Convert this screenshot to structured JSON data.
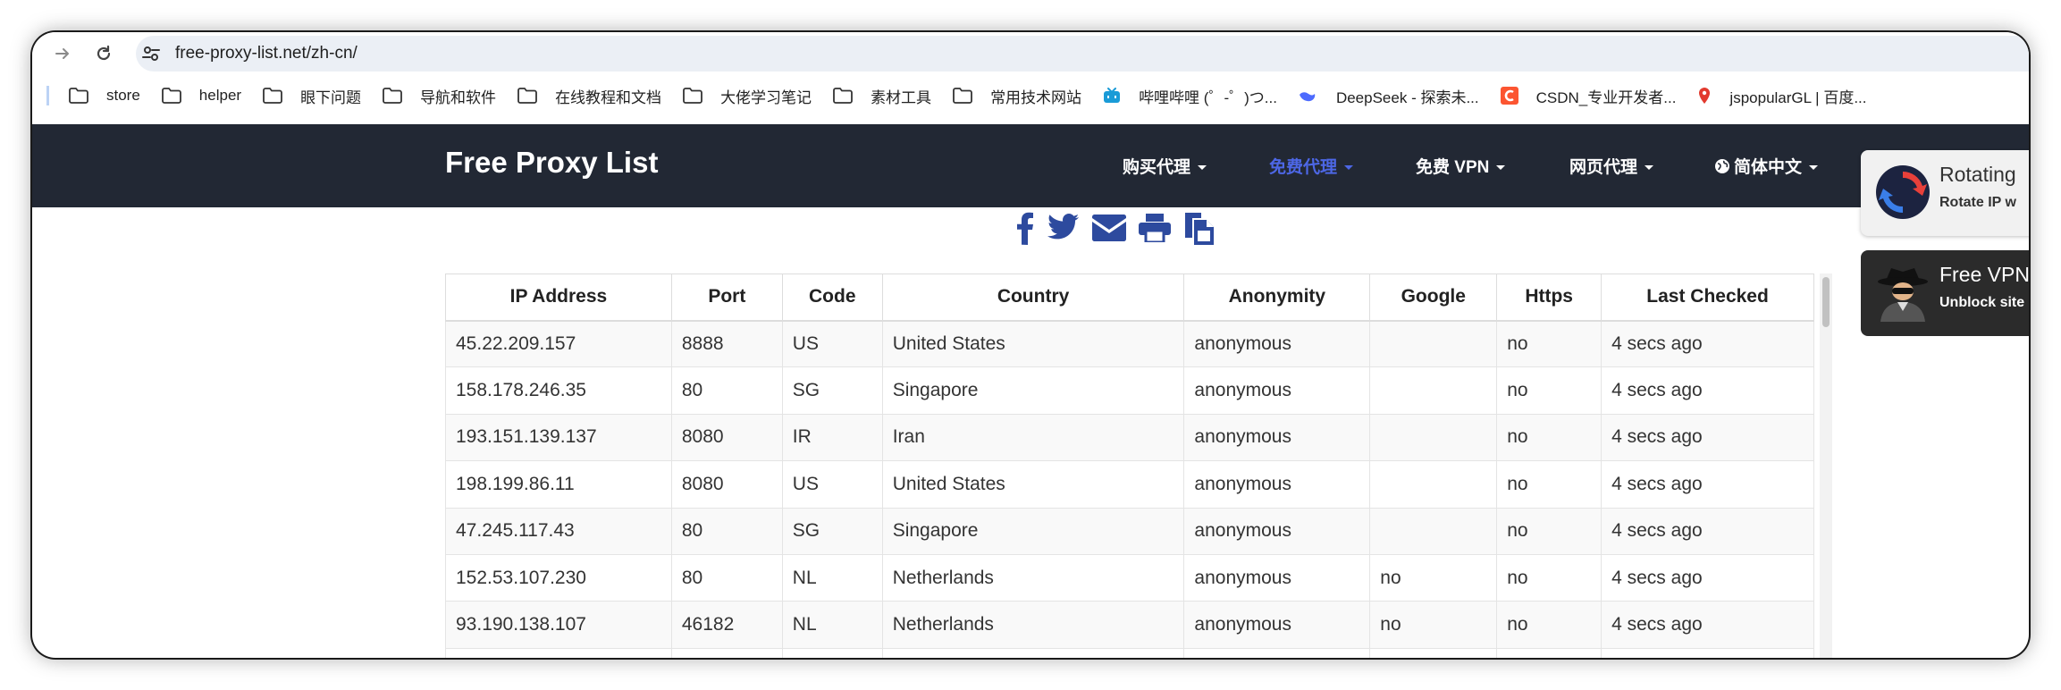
{
  "browser": {
    "url": "free-proxy-list.net/zh-cn/",
    "bookmarks": [
      {
        "label": "store",
        "icon": "folder-icon"
      },
      {
        "label": "helper",
        "icon": "folder-icon"
      },
      {
        "label": "眼下问题",
        "icon": "folder-icon"
      },
      {
        "label": "导航和软件",
        "icon": "folder-icon"
      },
      {
        "label": "在线教程和文档",
        "icon": "folder-icon"
      },
      {
        "label": "大佬学习笔记",
        "icon": "folder-icon"
      },
      {
        "label": "素材工具",
        "icon": "folder-icon"
      },
      {
        "label": "常用技术网站",
        "icon": "folder-icon"
      },
      {
        "label": "哔哩哔哩 (゜-゜)つ...",
        "icon": "bilibili-icon"
      },
      {
        "label": "DeepSeek - 探索未...",
        "icon": "deepseek-icon"
      },
      {
        "label": "CSDN_专业开发者...",
        "icon": "csdn-icon"
      },
      {
        "label": "jspopularGL | 百度...",
        "icon": "map-pin-icon"
      }
    ]
  },
  "site": {
    "brand": "Free Proxy List",
    "menu": [
      {
        "label": "购买代理",
        "active": false
      },
      {
        "label": "免费代理",
        "active": true
      },
      {
        "label": "免费 VPN",
        "active": false
      },
      {
        "label": "网页代理",
        "active": false
      },
      {
        "label": "简体中文",
        "active": false,
        "icon": "globe-icon"
      }
    ],
    "accent_color": "#4d67e6",
    "header_color": "#222834",
    "share_color": "#2d4a9e"
  },
  "share_icons": [
    "facebook-icon",
    "twitter-icon",
    "email-icon",
    "print-icon",
    "copy-icon"
  ],
  "table": {
    "headers": [
      "IP Address",
      "Port",
      "Code",
      "Country",
      "Anonymity",
      "Google",
      "Https",
      "Last Checked"
    ],
    "rows": [
      [
        "45.22.209.157",
        "8888",
        "US",
        "United States",
        "anonymous",
        "",
        "no",
        "4 secs ago"
      ],
      [
        "158.178.246.35",
        "80",
        "SG",
        "Singapore",
        "anonymous",
        "",
        "no",
        "4 secs ago"
      ],
      [
        "193.151.139.137",
        "8080",
        "IR",
        "Iran",
        "anonymous",
        "",
        "no",
        "4 secs ago"
      ],
      [
        "198.199.86.11",
        "8080",
        "US",
        "United States",
        "anonymous",
        "",
        "no",
        "4 secs ago"
      ],
      [
        "47.245.117.43",
        "80",
        "SG",
        "Singapore",
        "anonymous",
        "",
        "no",
        "4 secs ago"
      ],
      [
        "152.53.107.230",
        "80",
        "NL",
        "Netherlands",
        "anonymous",
        "no",
        "no",
        "4 secs ago"
      ],
      [
        "93.190.138.107",
        "46182",
        "NL",
        "Netherlands",
        "anonymous",
        "no",
        "no",
        "4 secs ago"
      ],
      [
        "",
        "",
        "",
        "",
        "",
        "",
        "",
        ""
      ]
    ]
  },
  "ads": [
    {
      "title": "Rotating",
      "subtitle": "Rotate IP w",
      "icon": "rotate-icon"
    },
    {
      "title": "Free VPN",
      "subtitle": "Unblock site",
      "icon": "spy-icon"
    }
  ]
}
